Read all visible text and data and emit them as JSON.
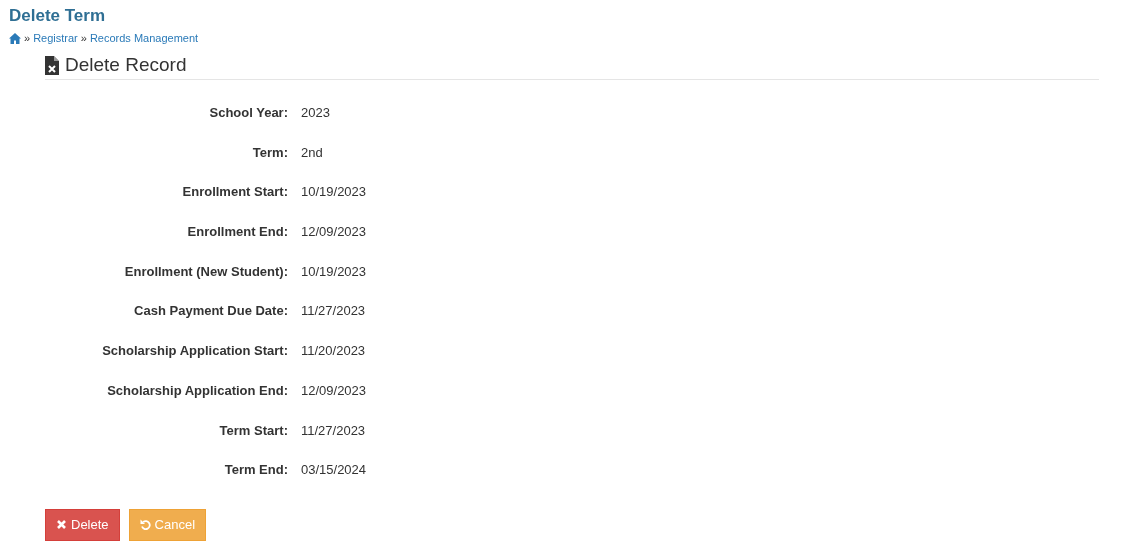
{
  "page_title": "Delete Term",
  "breadcrumb": [
    {
      "label": "Registrar",
      "separator": "»"
    },
    {
      "label": "Records Management",
      "separator": "»"
    }
  ],
  "section_title": "Delete Record",
  "fields": [
    {
      "label": "School Year:",
      "value": "2023"
    },
    {
      "label": "Term:",
      "value": "2nd"
    },
    {
      "label": "Enrollment Start:",
      "value": "10/19/2023"
    },
    {
      "label": "Enrollment End:",
      "value": "12/09/2023"
    },
    {
      "label": "Enrollment (New Student):",
      "value": "10/19/2023"
    },
    {
      "label": "Cash Payment Due Date:",
      "value": "11/27/2023"
    },
    {
      "label": "Scholarship Application Start:",
      "value": "11/20/2023"
    },
    {
      "label": "Scholarship Application End:",
      "value": "12/09/2023"
    },
    {
      "label": "Term Start:",
      "value": "11/27/2023"
    },
    {
      "label": "Term End:",
      "value": "03/15/2024"
    }
  ],
  "buttons": [
    {
      "label": "Delete",
      "kind": "delete"
    },
    {
      "label": "Cancel",
      "kind": "cancel"
    }
  ]
}
